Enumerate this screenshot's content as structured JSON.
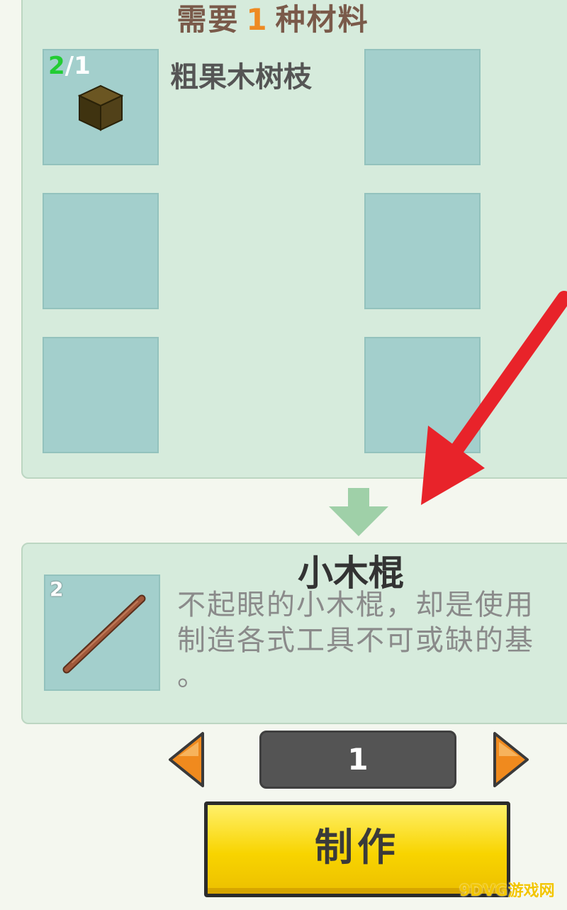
{
  "materials_panel": {
    "prefix": "需要",
    "count": "1",
    "suffix": "种材料",
    "slot1": {
      "have": "2",
      "sep": "/",
      "need": "1",
      "name": "粗果木树枝",
      "icon": "dark-wood-cube-icon"
    }
  },
  "result": {
    "title": "小木棍",
    "count": "2",
    "icon": "wooden-stick-icon",
    "description": [
      "不起眼的小木棍，却是使用",
      "制造各式工具不可或缺的基",
      "。"
    ]
  },
  "quantity": {
    "value": "1"
  },
  "craft_button": {
    "label": "制作"
  },
  "watermark": {
    "text": "9DVG游戏网"
  },
  "colors": {
    "panel_bg": "#d6ebdc",
    "slot_bg": "#a3cfcc",
    "count_have": "#22cc33",
    "header_count": "#ee8a22",
    "craft_button": "#f8d400",
    "arrow_button": "#f08a1e",
    "annotation_arrow": "#e8232a"
  }
}
